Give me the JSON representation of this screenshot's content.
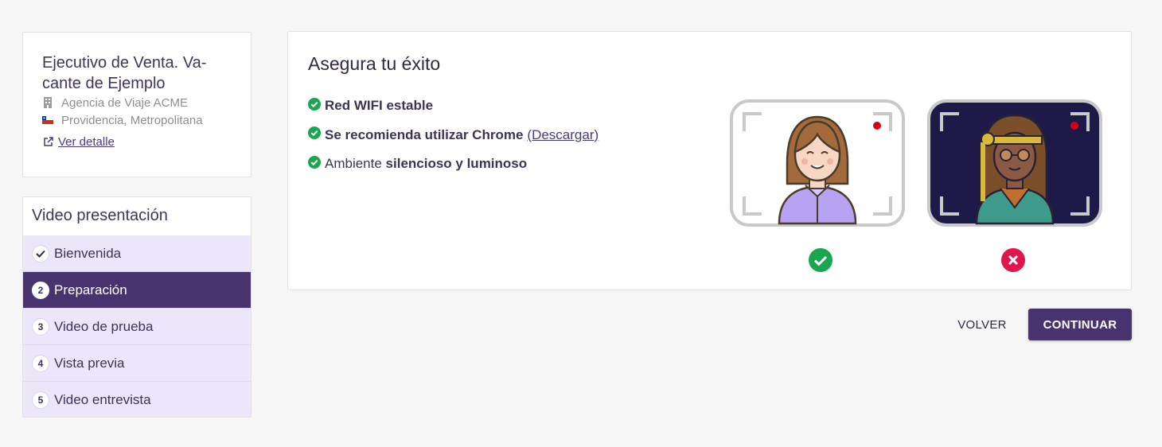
{
  "job": {
    "title": "Ejecutivo de Venta. Va-cante de Ejemplo",
    "company": "Agencia de Viaje ACME",
    "location": "Providencia, Metropolitana",
    "detail_link": "Ver detalle",
    "company_icon": "building-icon",
    "location_icon": "chile-flag-icon",
    "detail_icon": "external-link-icon"
  },
  "steps": {
    "title": "Video presentación",
    "items": [
      {
        "marker": "✓",
        "label": "Bienvenida",
        "state": "done"
      },
      {
        "marker": "2",
        "label": "Preparación",
        "state": "active"
      },
      {
        "marker": "3",
        "label": "Video de prueba",
        "state": "pending"
      },
      {
        "marker": "4",
        "label": "Vista previa",
        "state": "pending"
      },
      {
        "marker": "5",
        "label": "Video entrevista",
        "state": "pending"
      }
    ]
  },
  "main": {
    "title": "Asegura tu éxito",
    "tips": [
      {
        "strong": "Red WIFI estable"
      },
      {
        "strong": "Se recomienda utilizar Chrome",
        "link": "(Descargar)"
      },
      {
        "plain": "Ambiente ",
        "strong": "silencioso y luminoso"
      }
    ],
    "good_example_icon": "check-circle-icon",
    "bad_example_icon": "x-circle-icon"
  },
  "buttons": {
    "back": "VOLVER",
    "continue": "CONTINUAR"
  },
  "colors": {
    "primary": "#48336f",
    "step_bg": "#ece6fa",
    "success": "#1aa650",
    "error": "#e0174b"
  }
}
